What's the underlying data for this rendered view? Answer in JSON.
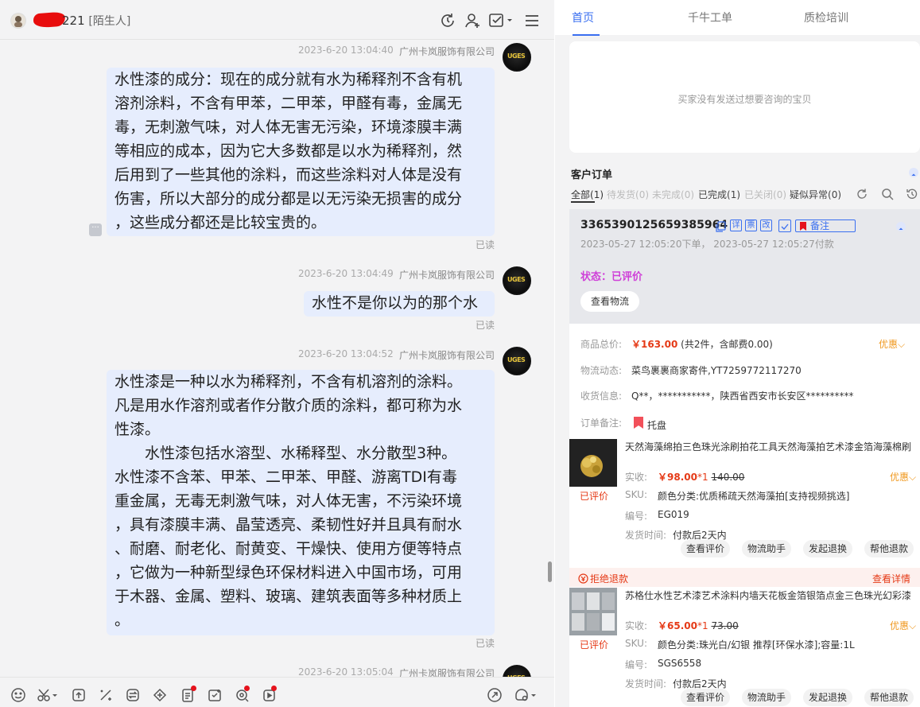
{
  "header": {
    "username_suffix": "221",
    "tag": "[陌生人]",
    "icons": [
      "refresh-icon",
      "add-user-icon",
      "task-check-icon",
      "menu-icon"
    ]
  },
  "messages": [
    {
      "time": "2023-6-20 13:04:40",
      "sender": "广州卡岚服饰有限公司",
      "lines": [
        "水性漆的成分：现在的成分就有水为稀释剂不含有机",
        "溶剂涂料，不含有甲苯，二甲苯，甲醛有毒，金属无",
        "毒，无刺激气味，对人体无害无污染，环境漆膜丰满",
        "等相应的成本，因为它大多数都是以水为稀释剂，然",
        "后用到了一些其他的涂料，而这些涂料对人体是没有",
        "伤害，所以大部分的成分都是以无污染无损害的成分",
        "，这些成分都还是比较宝贵的。"
      ],
      "status": "已读"
    },
    {
      "time": "2023-6-20 13:04:49",
      "sender": "广州卡岚服饰有限公司",
      "lines": [
        "水性不是你以为的那个水"
      ],
      "status": "已读"
    },
    {
      "time": "2023-6-20 13:04:52",
      "sender": "广州卡岚服饰有限公司",
      "lines": [
        "水性漆是一种以水为稀释剂，不含有机溶剂的涂料。",
        "凡是用水作溶剂或者作分散介质的涂料，都可称为水",
        "性漆。",
        "　　水性漆包括水溶型、水稀释型、水分散型3种。",
        "水性漆不含苯、甲苯、二甲苯、甲醛、游离TDI有毒",
        "重金属，无毒无刺激气味，对人体无害，不污染环境",
        "，具有漆膜丰满、晶莹透亮、柔韧性好并且具有耐水",
        "、耐磨、耐老化、耐黄变、干燥快、使用方便等特点",
        "，它做为一种新型绿色环保材料进入中国市场，可用",
        "于木器、金属、塑料、玻璃、建筑表面等多种材质上",
        "。"
      ],
      "status": "已读"
    },
    {
      "time": "2023-6-20 13:05:04",
      "sender": "广州卡岚服饰有限公司"
    }
  ],
  "avatar_text": "UGES",
  "toolbar_icons": [
    "emoji-icon",
    "scissors-icon",
    "upload-icon",
    "discount-icon",
    "transfer-icon",
    "coupon-icon",
    "order-icon",
    "card-icon",
    "search-product-icon",
    "quick-reply-icon",
    "send-icon",
    "settings-icon"
  ],
  "right": {
    "tabs": [
      "首页",
      "千牛工单",
      "质检培训"
    ],
    "empty_goods": "买家没有发送过想要咨询的宝贝",
    "orders_title": "客户订单",
    "filters": [
      {
        "label": "全部",
        "count": "(1)"
      },
      {
        "label": "待发货",
        "count": "(0)"
      },
      {
        "label": "未完成",
        "count": "(0)"
      },
      {
        "label": "已完成",
        "count": "(1)"
      },
      {
        "label": "已关闭",
        "count": "(0)"
      },
      {
        "label": "疑似异常",
        "count": "(0)"
      }
    ],
    "order": {
      "number": "3365390125659385964",
      "icon_labels": [
        "详",
        "票",
        "改"
      ],
      "note_btn": "备注",
      "order_time": "2023-05-27 12:05:20下单，",
      "pay_time": "2023-05-27 12:05:27付款",
      "status": "状态：已评价",
      "logistics_btn": "查看物流",
      "total_label": "商品总价:",
      "total_price": "￥163.00",
      "total_note": "(共2件，含邮费0.00)",
      "discount": "优惠",
      "logistics_label": "物流动态:",
      "logistics_value": "菜鸟裹裹商家寄件,YT7259772117270",
      "address_label": "收货信息:",
      "address_value": "Q**，***********，陕西省西安市长安区**********",
      "remark_label": "订单备注:",
      "remark_value": "托盘"
    },
    "items": [
      {
        "title": "天然海藻绵拍三色珠光涂刷拍花工具天然海藻拍艺术漆金箔海藻棉刷",
        "pay_label": "实收:",
        "price": "￥98.00",
        "qty": "*1",
        "orig": "140.00",
        "discount": "优惠",
        "rated": "已评价",
        "sku_label": "SKU:",
        "sku": "颜色分类:优质稀疏天然海藻拍[支持视频挑选]",
        "code_label": "编号:",
        "code": "EG019",
        "ship_label": "发货时间:",
        "ship": "付款后2天内",
        "buttons": [
          "查看评价",
          "物流助手",
          "发起退换",
          "帮他退款"
        ]
      },
      {
        "refund_notice": "拒绝退款",
        "refund_detail": "查看详情",
        "title": "苏格仕水性艺术漆艺术涂料内墙天花板金箔银箔点金三色珠光幻彩漆",
        "pay_label": "实收:",
        "price": "￥65.00",
        "qty": "*1",
        "orig": "73.00",
        "discount": "优惠",
        "rated": "已评价",
        "sku_label": "SKU:",
        "sku": "颜色分类:珠光白/幻银 推荐[环保水漆];容量:1L",
        "code_label": "编号:",
        "code": "SGS6558",
        "ship_label": "发货时间:",
        "ship": "付款后2天内",
        "buttons": [
          "查看评价",
          "物流助手",
          "发起退换",
          "帮他退款"
        ]
      }
    ]
  },
  "colors": {
    "accent": "#3a6ff0",
    "bubble": "#e6edfd",
    "status": "#cf3fd8",
    "price": "#e53a17",
    "discount": "#f09a22",
    "redact": "#e80d0d"
  }
}
